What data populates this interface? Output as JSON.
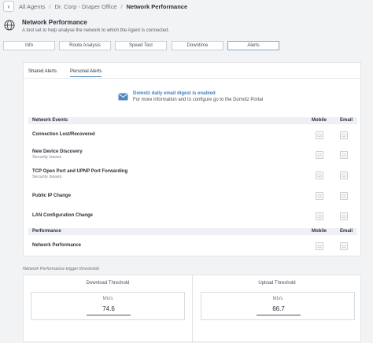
{
  "breadcrumb": {
    "back_icon": "chevron-left-icon",
    "items": [
      "All Agents",
      "Dr. Corp - Draper Office",
      "Network Performance"
    ],
    "separator": "/"
  },
  "header": {
    "icon": "globe-icon",
    "title": "Network Performance",
    "subtitle": "A tool set to help analyse the network to which the Agent is connected."
  },
  "tabs": [
    {
      "label": "Info",
      "active": false
    },
    {
      "label": "Route Analysis",
      "active": false
    },
    {
      "label": "Speed Test",
      "active": false
    },
    {
      "label": "Downtime",
      "active": false
    },
    {
      "label": "Alerts",
      "active": true
    }
  ],
  "alerts": {
    "subtabs": [
      {
        "label": "Shared Alerts",
        "active": false
      },
      {
        "label": "Personal Alerts",
        "active": true
      }
    ],
    "digest": {
      "icon": "email-icon",
      "title": "Domotz daily email digest is enabled",
      "text": "For more information and to configure go to the Domotz Portal"
    },
    "network_events": {
      "header": "Network Events",
      "mobile_label": "Mobile",
      "email_label": "Email",
      "rows": [
        {
          "name": "Connection Lost/Recovered",
          "sub": ""
        },
        {
          "name": "New Device Discovery",
          "sub": "Security Issues"
        },
        {
          "name": "TCP Open Port and UPNP Port Forwarding",
          "sub": "Security Issues"
        },
        {
          "name": "Public IP Change",
          "sub": ""
        },
        {
          "name": "LAN Configuration Change",
          "sub": ""
        }
      ]
    },
    "performance": {
      "header": "Performance",
      "mobile_label": "Mobile",
      "email_label": "Email",
      "rows": [
        {
          "name": "Network Performance",
          "sub": ""
        }
      ]
    }
  },
  "thresholds": {
    "caption": "Network Performance trigger thresholds",
    "download": {
      "title": "Download Threshold",
      "unit": "Mb/s",
      "value": "74.6"
    },
    "upload": {
      "title": "Upload Threshold",
      "unit": "Mb/s",
      "value": "66.7"
    }
  },
  "colors": {
    "accent": "#4d86c6",
    "link": "#3f7fc2",
    "tab_active_border": "#7fa8d6"
  }
}
